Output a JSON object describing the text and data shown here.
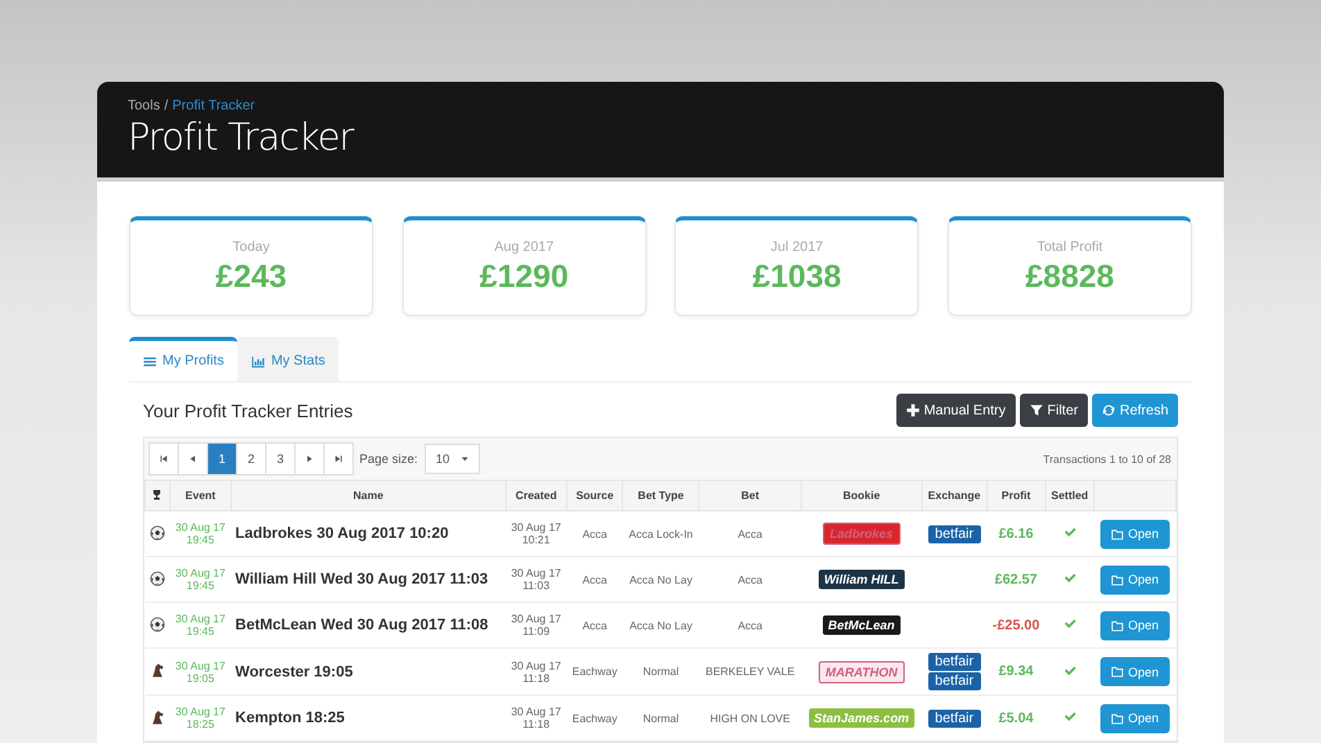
{
  "breadcrumb": {
    "parent": "Tools",
    "current": "Profit Tracker",
    "separator": "/"
  },
  "title": "Profit Tracker",
  "stats": [
    {
      "label": "Today",
      "value": "£243"
    },
    {
      "label": "Aug 2017",
      "value": "£1290"
    },
    {
      "label": "Jul 2017",
      "value": "£1038"
    },
    {
      "label": "Total Profit",
      "value": "£8828"
    }
  ],
  "tabs": [
    {
      "label": "My Profits",
      "selected": true
    },
    {
      "label": "My Stats",
      "selected": false
    }
  ],
  "section_title": "Your Profit Tracker Entries",
  "buttons": [
    {
      "label": "Manual Entry",
      "kind": "dark"
    },
    {
      "label": "Filter",
      "kind": "dark"
    },
    {
      "label": "Refresh",
      "kind": "primary"
    }
  ],
  "pagination": {
    "pages": [
      {
        "label": "1",
        "selected": true
      },
      {
        "label": "2",
        "selected": false
      },
      {
        "label": "3",
        "selected": false
      }
    ],
    "page_size_label": "Page size:",
    "page_size": "10",
    "summary": "Transactions 1 to 10 of 28"
  },
  "table": {
    "columns": [
      "Event",
      "Name",
      "Created",
      "Source",
      "Bet Type",
      "Bet",
      "Bookie",
      "Exchange",
      "Profit",
      "Settled"
    ],
    "rows": [
      {
        "kind": "football",
        "event": [
          "30 Aug 17",
          "19:45"
        ],
        "name": "Ladbrokes 30 Aug 2017 10:20",
        "created": [
          "30 Aug 17",
          "10:21"
        ],
        "source": "Acca",
        "bet_type": "Acca Lock-In",
        "bet": "Acca",
        "bookie": {
          "label": "Ladbrokes",
          "color": "#d8262c"
        },
        "exchange": [
          "betfair"
        ],
        "profit": "£6.16",
        "loss": false,
        "settled": true,
        "action": "Open"
      },
      {
        "kind": "football",
        "event": [
          "30 Aug 17",
          "19:45"
        ],
        "name": "William Hill Wed 30 Aug 2017 11:03",
        "created": [
          "30 Aug 17",
          "11:03"
        ],
        "source": "Acca",
        "bet_type": "Acca No Lay",
        "bet": "Acca",
        "bookie": {
          "label": "William HILL",
          "color": "#1d3446"
        },
        "exchange": [],
        "profit": "£62.57",
        "loss": false,
        "settled": true,
        "action": "Open"
      },
      {
        "kind": "football",
        "event": [
          "30 Aug 17",
          "19:45"
        ],
        "name": "BetMcLean Wed 30 Aug 2017 11:08",
        "created": [
          "30 Aug 17",
          "11:09"
        ],
        "source": "Acca",
        "bet_type": "Acca No Lay",
        "bet": "Acca",
        "bookie": {
          "label": "BetMcLean",
          "color": "#1a1a1a"
        },
        "exchange": [],
        "profit": "-£25.00",
        "loss": true,
        "settled": true,
        "action": "Open"
      },
      {
        "kind": "horse",
        "event": [
          "30 Aug 17",
          "19:05"
        ],
        "name": "Worcester 19:05",
        "created": [
          "30 Aug 17",
          "11:18"
        ],
        "source": "Eachway",
        "bet_type": "Normal",
        "bet": "BERKELEY VALE",
        "bookie": {
          "label": "MARATHON",
          "color": "#fbe9ee"
        },
        "exchange": [
          "betfair",
          "betfair"
        ],
        "profit": "£9.34",
        "loss": false,
        "settled": true,
        "action": "Open"
      },
      {
        "kind": "horse",
        "event": [
          "30 Aug 17",
          "18:25"
        ],
        "name": "Kempton 18:25",
        "created": [
          "30 Aug 17",
          "11:18"
        ],
        "source": "Eachway",
        "bet_type": "Normal",
        "bet": "HIGH ON LOVE",
        "bookie": {
          "label": "StanJames.com",
          "color": "#8cbf3f"
        },
        "exchange": [
          "betfair"
        ],
        "profit": "£5.04",
        "loss": false,
        "settled": true,
        "action": "Open"
      }
    ]
  }
}
